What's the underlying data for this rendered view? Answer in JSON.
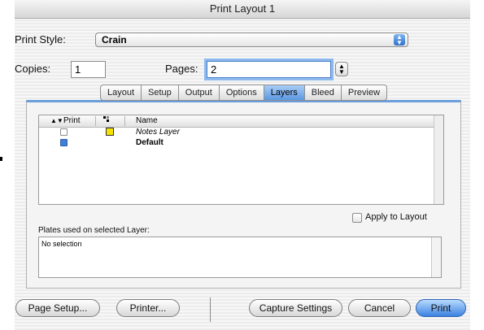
{
  "window": {
    "title": "Print Layout 1"
  },
  "print_style": {
    "label": "Print Style:",
    "value": "Crain"
  },
  "copies": {
    "label": "Copies:",
    "value": "1"
  },
  "pages": {
    "label": "Pages:",
    "value": "2"
  },
  "tabs": [
    {
      "label": "Layout",
      "active": false
    },
    {
      "label": "Setup",
      "active": false
    },
    {
      "label": "Output",
      "active": false
    },
    {
      "label": "Options",
      "active": false
    },
    {
      "label": "Layers",
      "active": true
    },
    {
      "label": "Bleed",
      "active": false
    },
    {
      "label": "Preview",
      "active": false
    }
  ],
  "layers_table": {
    "columns": {
      "print": "Print",
      "name": "Name"
    },
    "rows": [
      {
        "print": false,
        "name": "Notes Layer",
        "color": "#f6e200"
      },
      {
        "print": true,
        "name": "Default"
      }
    ]
  },
  "apply_to_layout": {
    "label": "Apply to Layout",
    "checked": false
  },
  "plates": {
    "label": "Plates used on selected Layer:",
    "content": "No selection"
  },
  "buttons": {
    "page_setup": "Page Setup...",
    "printer": "Printer...",
    "capture_settings": "Capture Settings",
    "cancel": "Cancel",
    "print": "Print"
  },
  "colors": {
    "accent": "#3d82e0",
    "tab_active": "#5c98e2",
    "swatch_notes": "#f6e200"
  }
}
